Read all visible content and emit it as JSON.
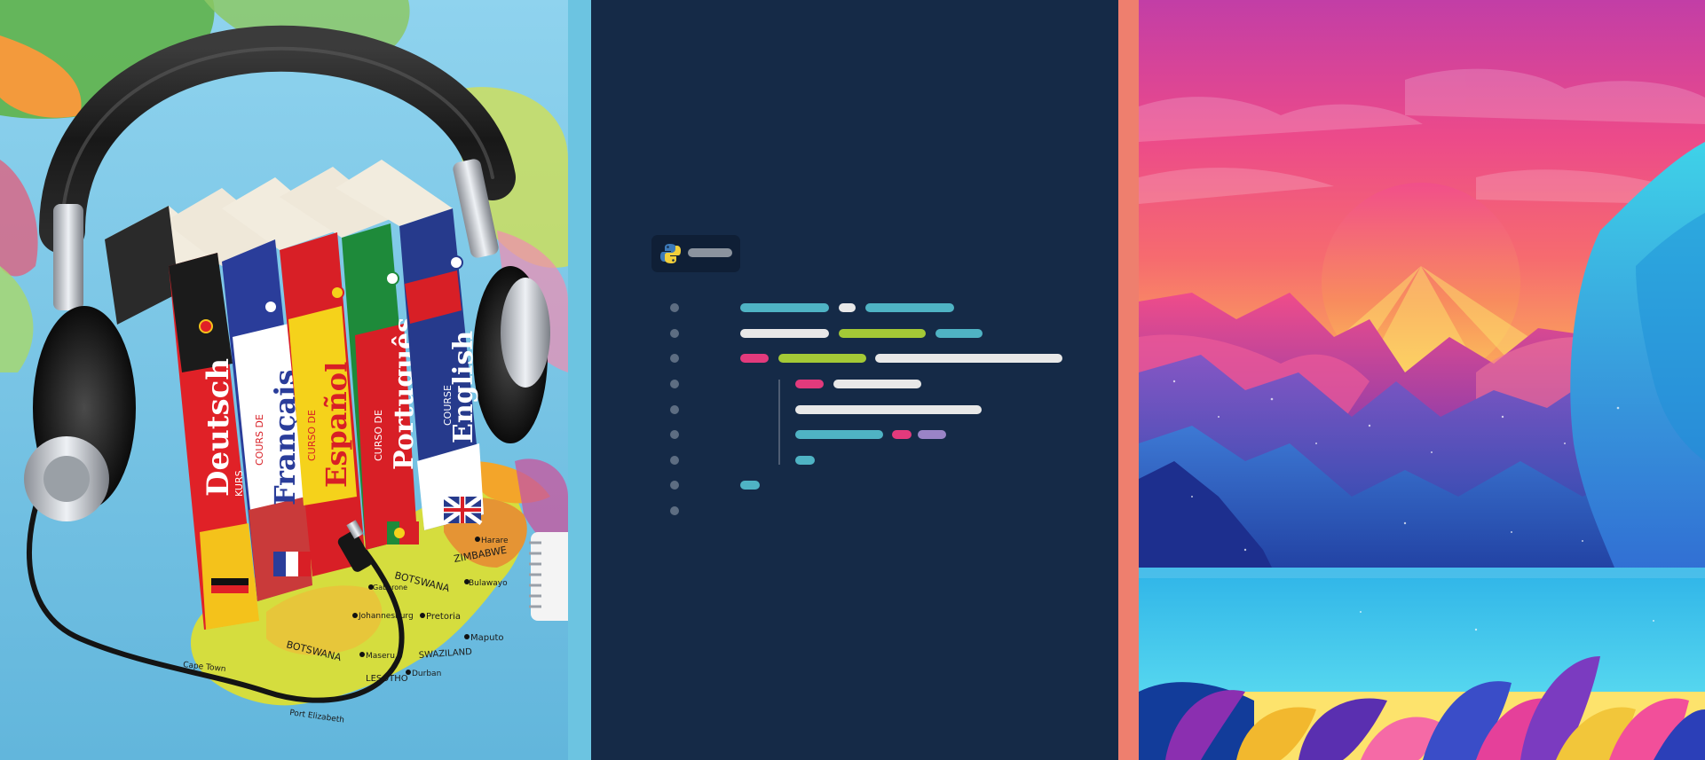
{
  "books": [
    {
      "title": "Deutsch",
      "subtitle": "KURS",
      "color": "#e02127"
    },
    {
      "title": "Français",
      "subtitle": "COURS DE",
      "color": "#2a3d9a"
    },
    {
      "title": "Español",
      "subtitle": "CURSO DE",
      "color": "#f5d21b"
    },
    {
      "title": "Português",
      "subtitle": "CURSO DE",
      "color": "#d81f26"
    },
    {
      "title": "English",
      "subtitle": "COURSE",
      "color": "#263a8c"
    }
  ],
  "map_labels": {
    "botswana_1": "BOTSWANA",
    "botswana_2": "BOTSWANA",
    "zimbabwe": "ZIMBABWE",
    "harare": "Harare",
    "bulawayo": "Bulawayo",
    "pretoria": "Pretoria",
    "johannesburg": "Johannesburg",
    "maputo": "Maputo",
    "swaziland": "SWAZILAND",
    "lesotho": "LESOTHO",
    "durban": "Durban",
    "cape_town": "Cape Town",
    "port_elizabeth": "Port Elizabeth",
    "maseru": "Maseru",
    "gaborone": "Gaborone"
  },
  "code_panel": {
    "icon": "python-logo-icon",
    "colors": {
      "background": "#152a47",
      "cyan": "#4fb3c4",
      "white": "#e8e8e8",
      "green": "#a4c936",
      "pink": "#e23a7c",
      "purple": "#9a84c7",
      "gutter": "#5d6d82"
    },
    "line_count": 9
  },
  "colors": {
    "strip_blue": "#6cc4e1",
    "strip_salmon": "#ee7f6e"
  }
}
